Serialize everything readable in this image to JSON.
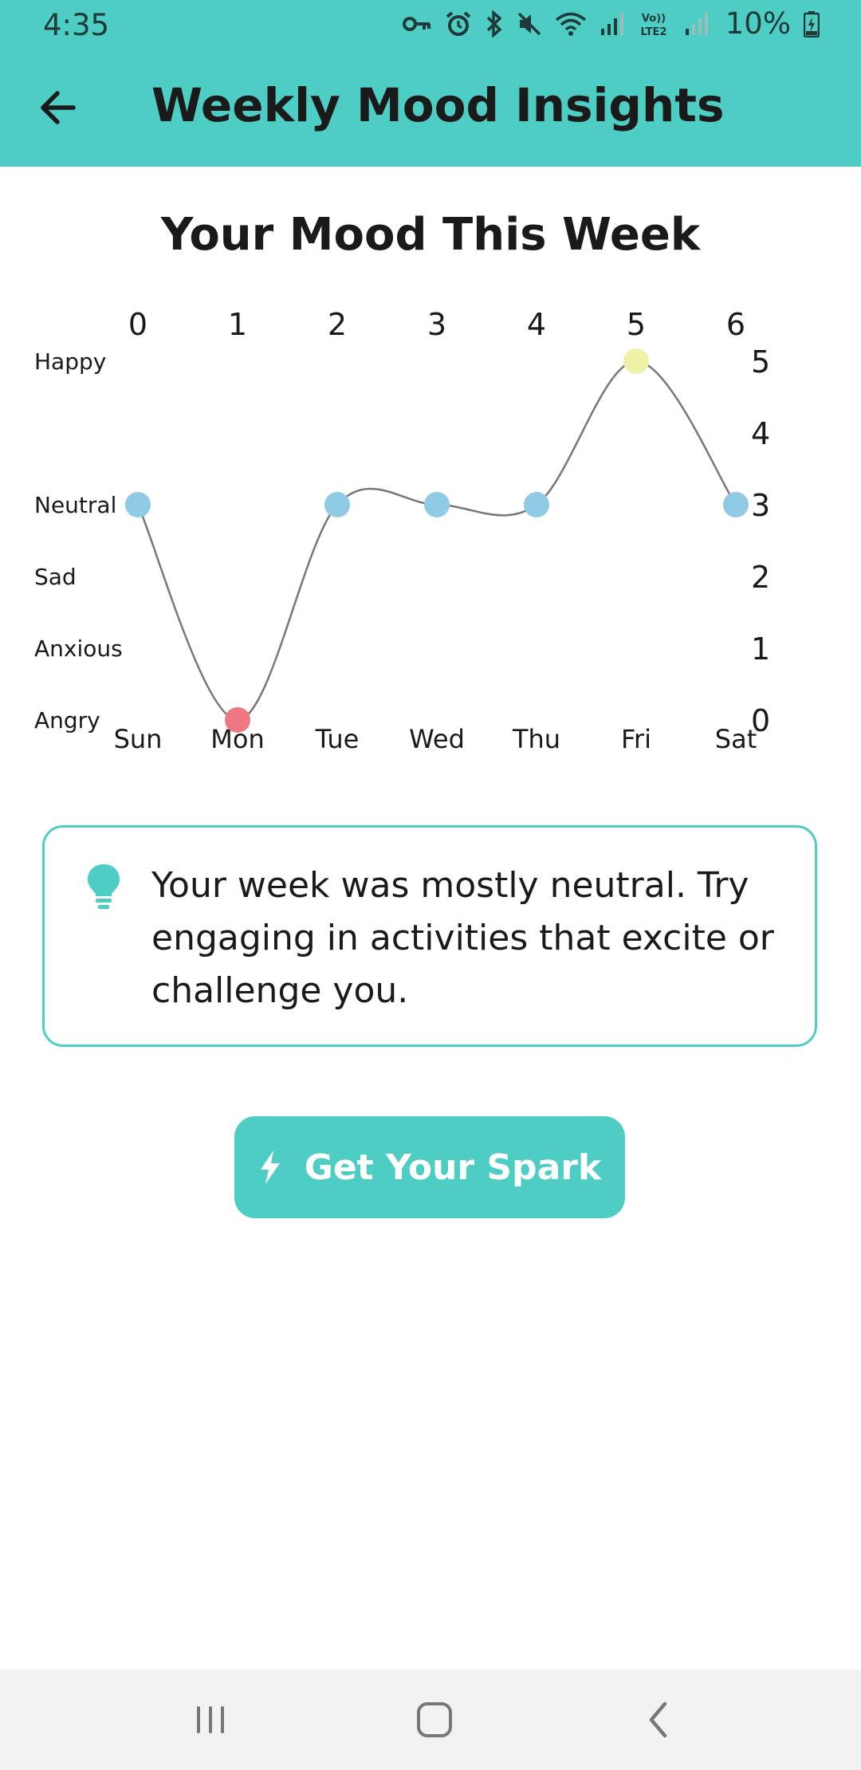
{
  "status_bar": {
    "time": "4:35",
    "battery": "10%",
    "icons": [
      "vpn-key-icon",
      "alarm-icon",
      "bluetooth-icon",
      "mute-icon",
      "wifi-icon",
      "signal-icon",
      "volte-icon",
      "signal-icon",
      "battery-charging-icon"
    ],
    "volte_top": "Vo))",
    "volte_bottom": "LTE2"
  },
  "header": {
    "title": "Weekly Mood Insights",
    "color": "#4ecdc4"
  },
  "chart_title": "Your Mood This Week",
  "chart_data": {
    "type": "line",
    "x": [
      0,
      1,
      2,
      3,
      4,
      5,
      6
    ],
    "categories": [
      "Sun",
      "Mon",
      "Tue",
      "Wed",
      "Thu",
      "Fri",
      "Sat"
    ],
    "series": [
      {
        "values": [
          3,
          0,
          3,
          3,
          3,
          5,
          3
        ]
      }
    ],
    "x_ticks": [
      "0",
      "1",
      "2",
      "3",
      "4",
      "5",
      "6"
    ],
    "y_ticks": [
      "0",
      "1",
      "2",
      "3",
      "4",
      "5"
    ],
    "mood_levels": [
      {
        "label": "Happy",
        "value": 5
      },
      {
        "label": "Neutral",
        "value": 3
      },
      {
        "label": "Sad",
        "value": 2
      },
      {
        "label": "Anxious",
        "value": 1
      },
      {
        "label": "Angry",
        "value": 0
      }
    ],
    "ylim": [
      0,
      5
    ],
    "grid": false,
    "line_color": "#777777",
    "point_colors": [
      "#90cbe6",
      "#ef7782",
      "#90cbe6",
      "#90cbe6",
      "#90cbe6",
      "#eef2a6",
      "#90cbe6"
    ]
  },
  "insight": {
    "icon": "lightbulb-icon",
    "text_lines": [
      "Your week was mostly neutral. Try",
      "engaging in activities that excite or",
      "challenge you."
    ]
  },
  "spark_button": {
    "label": "Get Your Spark",
    "icon": "bolt-icon"
  },
  "nav_bar": {
    "buttons": [
      "recent-apps",
      "home",
      "back"
    ]
  }
}
